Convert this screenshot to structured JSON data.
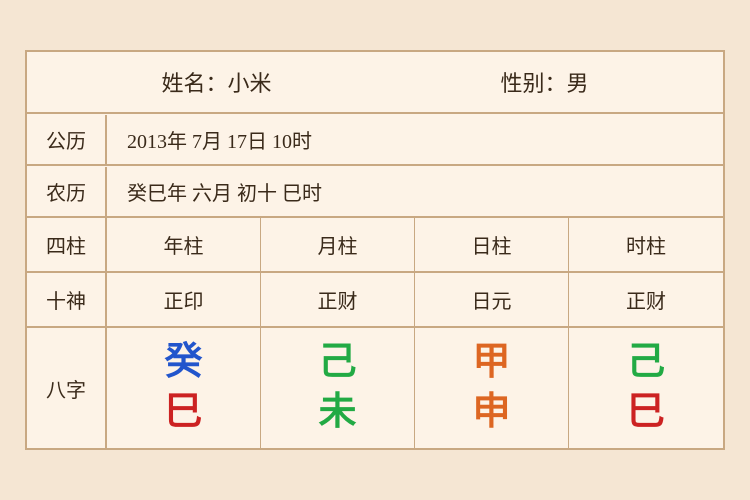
{
  "header": {
    "name_label": "姓名：小米",
    "gender_label": "性别：男"
  },
  "solar": {
    "label": "公历",
    "value": "2013年 7月 17日 10时"
  },
  "lunar": {
    "label": "农历",
    "value": "癸巳年 六月 初十 巳时"
  },
  "sizhu": {
    "label": "四柱",
    "columns": [
      "年柱",
      "月柱",
      "日柱",
      "时柱"
    ]
  },
  "shishen": {
    "label": "十神",
    "columns": [
      "正印",
      "正财",
      "日元",
      "正财"
    ]
  },
  "bazi": {
    "label": "八字",
    "columns": [
      {
        "top": "癸",
        "top_color": "color-blue",
        "bottom": "巳",
        "bottom_color": "color-red"
      },
      {
        "top": "己",
        "top_color": "color-green",
        "bottom": "未",
        "bottom_color": "color-green"
      },
      {
        "top": "甲",
        "top_color": "color-orange",
        "bottom": "申",
        "bottom_color": "color-orange"
      },
      {
        "top": "己",
        "top_color": "color-green",
        "bottom": "巳",
        "bottom_color": "color-red"
      }
    ]
  }
}
